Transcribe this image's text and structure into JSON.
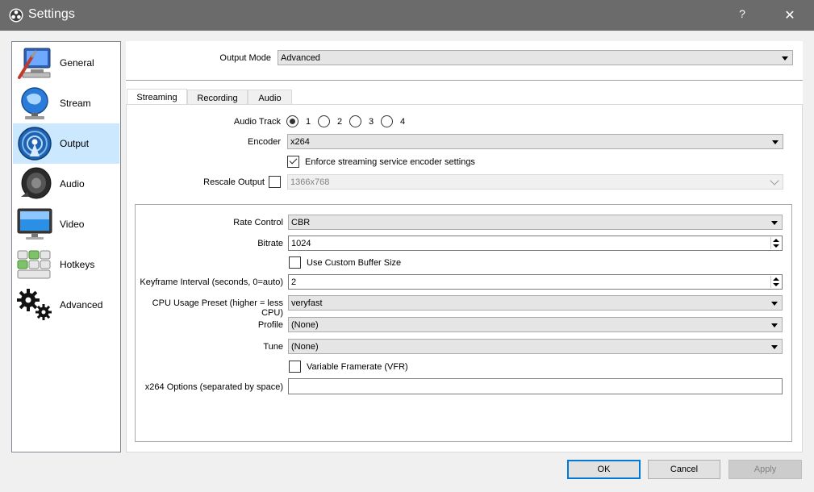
{
  "window": {
    "title": "Settings",
    "help": "?",
    "close": "✕"
  },
  "sidebar": {
    "items": [
      {
        "label": "General",
        "icon": "general-icon",
        "active": false
      },
      {
        "label": "Stream",
        "icon": "stream-icon",
        "active": false
      },
      {
        "label": "Output",
        "icon": "output-icon",
        "active": true
      },
      {
        "label": "Audio",
        "icon": "audio-icon",
        "active": false
      },
      {
        "label": "Video",
        "icon": "video-icon",
        "active": false
      },
      {
        "label": "Hotkeys",
        "icon": "hotkeys-icon",
        "active": false
      },
      {
        "label": "Advanced",
        "icon": "advanced-icon",
        "active": false
      }
    ]
  },
  "output_mode": {
    "label": "Output Mode",
    "value": "Advanced"
  },
  "tabs": [
    {
      "label": "Streaming",
      "active": true
    },
    {
      "label": "Recording",
      "active": false
    },
    {
      "label": "Audio",
      "active": false
    }
  ],
  "audio_track": {
    "label": "Audio Track",
    "options": [
      "1",
      "2",
      "3",
      "4"
    ],
    "selected": "1"
  },
  "encoder": {
    "label": "Encoder",
    "value": "x264"
  },
  "enforce": {
    "label": "Enforce streaming service encoder settings",
    "checked": true
  },
  "rescale": {
    "label": "Rescale Output",
    "checked": false,
    "value": "1366x768"
  },
  "rate_control": {
    "label": "Rate Control",
    "value": "CBR"
  },
  "bitrate": {
    "label": "Bitrate",
    "value": "1024"
  },
  "custom_buffer": {
    "label": "Use Custom Buffer Size",
    "checked": false
  },
  "keyframe": {
    "label": "Keyframe Interval (seconds, 0=auto)",
    "value": "2"
  },
  "cpu_preset": {
    "label": "CPU Usage Preset (higher = less CPU)",
    "value": "veryfast"
  },
  "profile": {
    "label": "Profile",
    "value": "(None)"
  },
  "tune": {
    "label": "Tune",
    "value": "(None)"
  },
  "vfr": {
    "label": "Variable Framerate (VFR)",
    "checked": false
  },
  "x264_options": {
    "label": "x264 Options (separated by space)",
    "value": ""
  },
  "buttons": {
    "ok": "OK",
    "cancel": "Cancel",
    "apply": "Apply"
  },
  "colors": {
    "titlebar": "#6b6b6b",
    "selection": "#cce8ff",
    "accent": "#0078d7"
  }
}
